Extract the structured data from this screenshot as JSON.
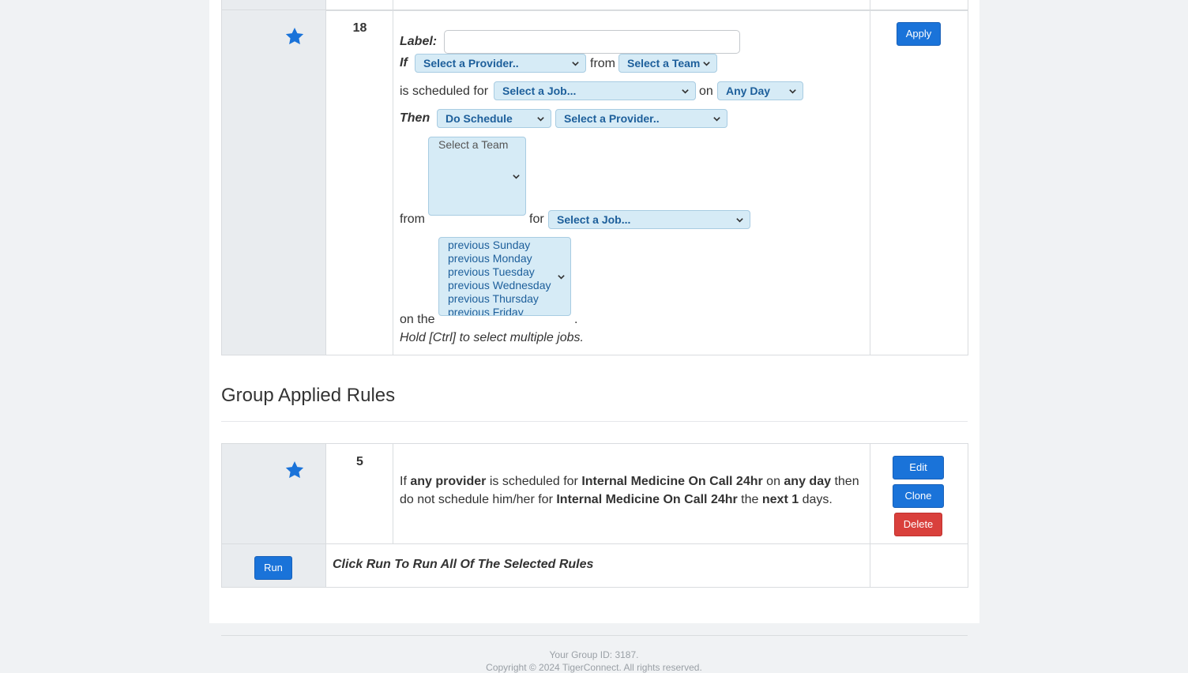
{
  "rule18": {
    "number": "18",
    "apply_label": "Apply",
    "label_text": "Label:",
    "label_value": "",
    "if_text": "If",
    "if_provider": "Select a Provider..",
    "from_text": "from",
    "if_team": "Select a Team",
    "scheduled_for_text": "is scheduled for",
    "job_select": "Select a Job...",
    "on_text": "on",
    "day_select": "Any Day",
    "then_text": "Then",
    "action_select": "Do Schedule",
    "then_provider": "Select a Provider..",
    "team_multi_placeholder": "Select a Team",
    "from2_text": "from",
    "for_text": "for",
    "then_job": "Select a Job...",
    "on_the_text": "on the",
    "period": ".",
    "day_options": [
      "previous Sunday",
      "previous Monday",
      "previous Tuesday",
      "previous Wednesday",
      "previous Thursday",
      "previous Friday"
    ],
    "hint": "Hold [Ctrl] to select multiple jobs."
  },
  "section": {
    "title": "Group Applied Rules"
  },
  "rule5": {
    "number": "5",
    "line1_a": "If ",
    "line1_b": "any provider",
    "line1_c": " is scheduled for ",
    "line1_d": "Internal Medicine On Call 24hr",
    "line1_e": " on ",
    "line1_f": "any day",
    "line1_g": " then",
    "line2_a": "do not schedule him/her for ",
    "line2_b": "Internal Medicine On Call 24hr",
    "line2_c": " the ",
    "line2_d": "next 1",
    "line2_e": " days.",
    "edit_label": "Edit",
    "clone_label": "Clone",
    "delete_label": "Delete"
  },
  "run_row": {
    "run_label": "Run",
    "text": "Click Run To Run All Of The Selected Rules"
  },
  "footer": {
    "group_id": "Your Group ID: 3187.",
    "copyright": "Copyright © 2024 TigerConnect. All rights reserved."
  },
  "colors": {
    "accent": "#1a73d9",
    "danger": "#d9403c",
    "select_bg": "#d6ebf6",
    "select_text": "#1d5f9b",
    "star": "#1a73d9"
  },
  "icons": {
    "star": "star-icon",
    "dropdown": "chevron-down-icon"
  }
}
